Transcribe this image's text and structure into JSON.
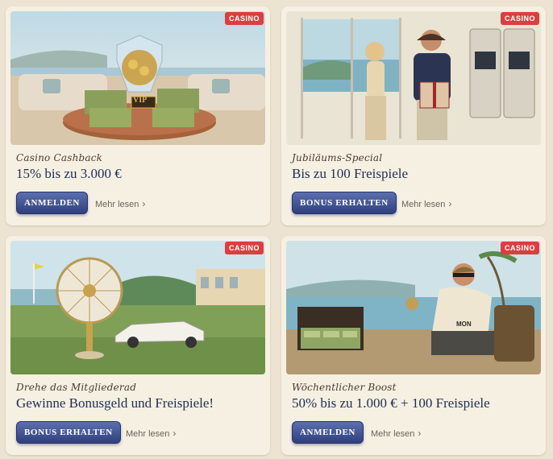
{
  "promotions": [
    {
      "badge": "CASINO",
      "subtitle": "Casino Cashback",
      "title": "15% bis zu 3.000 €",
      "button_label": "ANMELDEN",
      "more_label": "Mehr lesen",
      "chevron": "›",
      "art_badge_text": "VIP"
    },
    {
      "badge": "CASINO",
      "subtitle": "Jubiläums-Special",
      "title": "Bis zu 100 Freispiele",
      "button_label": "BONUS ERHALTEN",
      "more_label": "Mehr lesen",
      "chevron": "›"
    },
    {
      "badge": "CASINO",
      "subtitle": "Drehe das Mitgliederad",
      "title": "Gewinne Bonusgeld und Freispiele!",
      "button_label": "BONUS ERHALTEN",
      "more_label": "Mehr lesen",
      "chevron": "›"
    },
    {
      "badge": "CASINO",
      "subtitle": "Wöchentlicher Boost",
      "title": "50% bis zu 1.000 € + 100 Freispiele",
      "button_label": "ANMELDEN",
      "more_label": "Mehr lesen",
      "chevron": "›",
      "art_badge_text": "MON"
    }
  ],
  "colors": {
    "page_bg": "#ece3d2",
    "card_bg": "#f6f0e2",
    "badge_bg": "#d8403f",
    "button_top": "#5c6fae",
    "button_bottom": "#2f3f7e",
    "title_color": "#1f2d55"
  },
  "icons": {
    "chevron": "chevron-right-icon"
  }
}
